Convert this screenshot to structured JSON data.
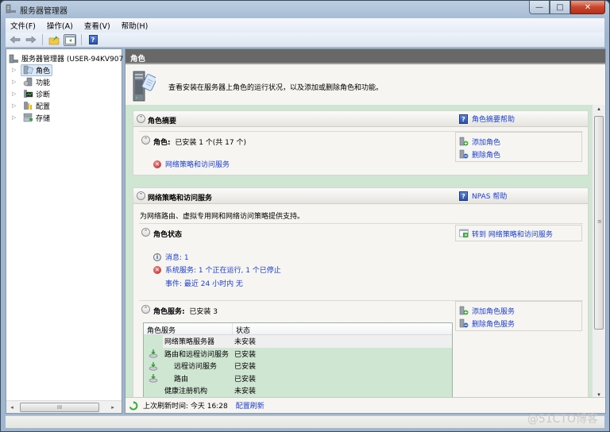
{
  "window": {
    "title": "服务器管理器",
    "controls": {
      "minimize": "—",
      "maximize": "□",
      "close": "✕"
    }
  },
  "menu": [
    {
      "label": "文件(F)"
    },
    {
      "label": "操作(A)"
    },
    {
      "label": "查看(V)"
    },
    {
      "label": "帮助(H)"
    }
  ],
  "toolbar": {
    "back": "back-arrow-icon",
    "forward": "forward-arrow-icon",
    "up_folder": "up-folder-icon",
    "show_hide_tree": "console-tree-icon",
    "help": "help-icon"
  },
  "tree": {
    "root": "服务器管理器 (USER-94KV907",
    "items": [
      {
        "label": "角色",
        "icon": "roles-icon",
        "selected": true
      },
      {
        "label": "功能",
        "icon": "features-icon"
      },
      {
        "label": "诊断",
        "icon": "diagnostics-icon"
      },
      {
        "label": "配置",
        "icon": "configuration-icon"
      },
      {
        "label": "存储",
        "icon": "storage-icon"
      }
    ],
    "scroll_grip": "III"
  },
  "main": {
    "header": "角色",
    "intro": "查看安装在服务器上角色的运行状况，以及添加或删除角色和功能。",
    "summary": {
      "title": "角色摘要",
      "help": "角色摘要帮助",
      "roles_label": "角色:",
      "roles_value": "已安装 1 个(共 17 个)",
      "role_link": "网络策略和访问服务",
      "actions": [
        "添加角色",
        "删除角色"
      ]
    },
    "npas": {
      "title": "网络策略和访问服务",
      "help": "NPAS 帮助",
      "description": "为网络路由、虚拟专用网和网络访问策略提供支持。",
      "status_title": "角色状态",
      "goto_action": "转到 网络策略和访问服务",
      "messages": "消息: 1",
      "system_services": "系统服务: 1 个正在运行, 1 个已停止",
      "events": "事件: 最近 24 小时内 无",
      "services_label": "角色服务:",
      "services_value": "已安装 3",
      "service_actions": [
        "添加角色服务",
        "删除角色服务"
      ],
      "table": {
        "columns": [
          "角色服务",
          "状态"
        ],
        "rows": [
          {
            "name": "网络策略服务器",
            "status": "未安装",
            "installed": false,
            "indent": 0
          },
          {
            "name": "路由和远程访问服务",
            "status": "已安装",
            "installed": true,
            "indent": 0
          },
          {
            "name": "远程访问服务",
            "status": "已安装",
            "installed": true,
            "indent": 1
          },
          {
            "name": "路由",
            "status": "已安装",
            "installed": true,
            "indent": 1
          },
          {
            "name": "健康注册机构",
            "status": "未安装",
            "installed": false,
            "indent": 0
          }
        ]
      }
    },
    "status_bar": {
      "last_refresh": "上次刷新时间: 今天 16:28",
      "configure_refresh": "配置刷新"
    }
  },
  "watermark": "@51CTO博客",
  "colors": {
    "link": "#1c3fd7",
    "header_bg": "#686868",
    "green_bg": "#cfe6d2",
    "close_btn": "#c9452b"
  }
}
